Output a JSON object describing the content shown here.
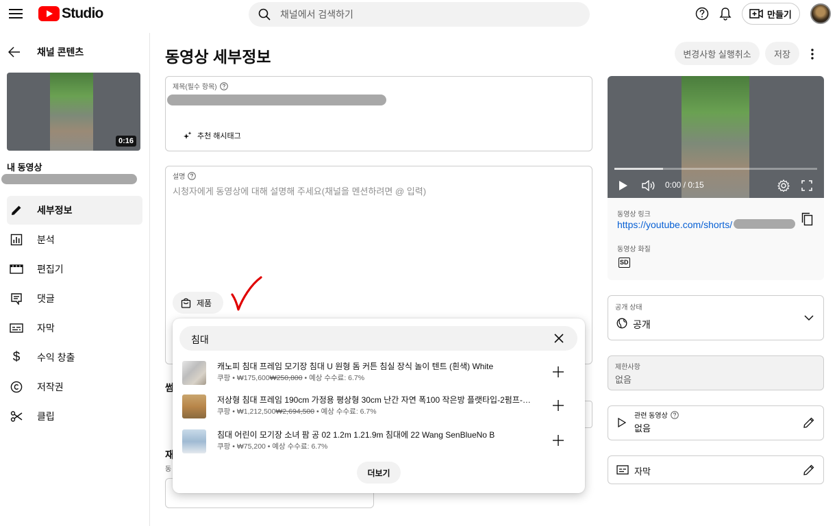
{
  "header": {
    "logo_text": "Studio",
    "search_placeholder": "채널에서 검색하기",
    "create_label": "만들기"
  },
  "sidebar": {
    "back_label": "채널 콘텐츠",
    "thumb_duration": "0:16",
    "my_video_label": "내 동영상",
    "items": [
      {
        "label": "세부정보",
        "icon": "pencil-icon"
      },
      {
        "label": "분석",
        "icon": "analytics-icon"
      },
      {
        "label": "편집기",
        "icon": "editor-icon"
      },
      {
        "label": "댓글",
        "icon": "comments-icon"
      },
      {
        "label": "자막",
        "icon": "subtitles-icon"
      },
      {
        "label": "수익 창출",
        "icon": "dollar-icon"
      },
      {
        "label": "저작권",
        "icon": "copyright-icon"
      },
      {
        "label": "클립",
        "icon": "scissors-icon"
      }
    ]
  },
  "main": {
    "page_title": "동영상 세부정보",
    "undo_label": "변경사항 실행취소",
    "save_label": "저장",
    "title_field_label": "제목(필수 항목)",
    "hashtag_label": "추천 해시태그",
    "description_label": "설명",
    "description_placeholder": "시청자에게 동영상에 대해 설명해 주세요(채널을 멘션하려면 @ 입력)",
    "products_button_label": "제품",
    "partial_label_1": "썸",
    "partial_label_2": "재",
    "partial_label_3": "동"
  },
  "product_popup": {
    "search_value": "침대",
    "results": [
      {
        "name": "캐노피 침대 프레임 모기장 침대 U 원형 돔 커튼 침실 장식 놀이 텐트 (흰색) White",
        "store": "쿠팡",
        "price": "₩175,600",
        "original_price": "₩250,800",
        "commission": "예상 수수료: 6.7%"
      },
      {
        "name": "저상형 침대 프레임 190cm 가정용 평상형 30cm 난간 자연 폭100 작은방 플랫타입-2펌프-옐...",
        "store": "쿠팡",
        "price": "₩1,212,500",
        "original_price": "₩2,694,500",
        "commission": "예상 수수료: 6.7%"
      },
      {
        "name": "침대 어린이 모기장 소녀 팜 공 02 1.2m 1.21.9m 침대에 22 Wang SenBlueNo B",
        "store": "쿠팡",
        "price": "₩75,200",
        "original_price": "",
        "commission": "예상 수수료: 6.7%"
      }
    ],
    "more_label": "더보기"
  },
  "right_panel": {
    "time_display": "0:00 / 0:15",
    "video_link_label": "동영상 링크",
    "video_link": "https://youtube.com/shorts/",
    "quality_label": "동영상 화질",
    "quality_badge": "SD",
    "visibility_label": "공개 상태",
    "visibility_value": "공개",
    "restrictions_label": "제한사항",
    "restrictions_value": "없음",
    "related_label": "관련 동영상",
    "related_value": "없음",
    "subtitles_label": "자막"
  },
  "colors": {
    "youtube_red": "#ff0000",
    "link_blue": "#065fd4",
    "checkmark_red": "#e00000"
  }
}
